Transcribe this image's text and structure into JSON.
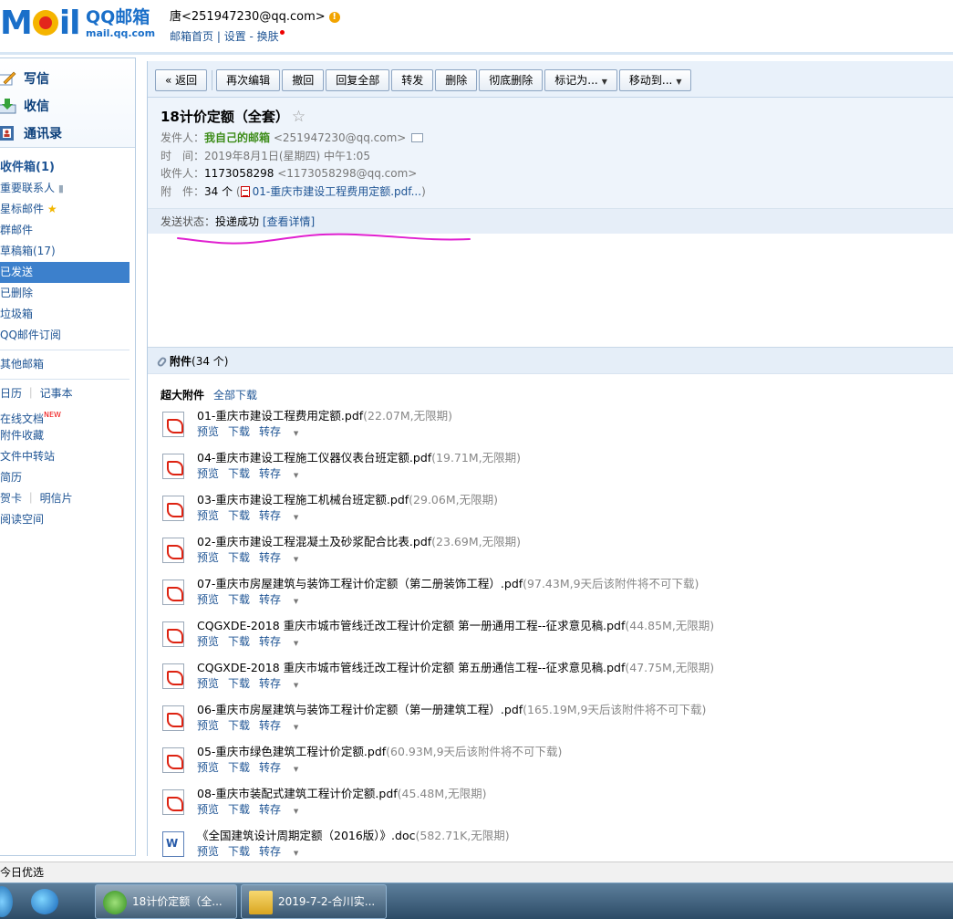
{
  "header": {
    "logo_text": "MOil",
    "brand_name": "QQ邮箱",
    "brand_domain": "mail.qq.com",
    "account_email": "唐<251947230@qq.com>",
    "links": [
      "邮箱首页",
      "设置",
      "换肤"
    ],
    "link_sep": " | ",
    "link_dash": " - "
  },
  "sidebar": {
    "actions": [
      "写信",
      "收信",
      "通讯录"
    ],
    "folders": [
      {
        "label": "收件箱(1)",
        "bold": true
      },
      {
        "label": "重要联系人"
      },
      {
        "label": "星标邮件"
      },
      {
        "label": "群邮件"
      },
      {
        "label": "草稿箱(17)"
      },
      {
        "label": "已发送",
        "selected": true
      },
      {
        "label": "已删除"
      },
      {
        "label": "垃圾箱"
      },
      {
        "label": "QQ邮件订阅"
      }
    ],
    "other_mailbox": "其他邮箱",
    "tools": {
      "calendar": "日历",
      "notes": "记事本",
      "docs": "在线文档",
      "docs_badge": "NEW",
      "favorites": "附件收藏",
      "transfer": "文件中转站",
      "resume": "简历",
      "card": "贺卡",
      "postcard": "明信片",
      "reading": "阅读空间"
    }
  },
  "toolbar": {
    "back": "« 返回",
    "reedit": "再次编辑",
    "recall": "撤回",
    "reply_all": "回复全部",
    "forward": "转发",
    "delete": "删除",
    "delete_perm": "彻底删除",
    "mark_as": "标记为...",
    "move_to": "移动到..."
  },
  "mail": {
    "subject": "18计价定额（全套）",
    "from_label": "发件人：",
    "from_name": "我自己的邮箱",
    "from_email": "<251947230@qq.com>",
    "time_label": "时　间：",
    "time_value": "2019年8月1日(星期四) 中午1:05",
    "to_label": "收件人：",
    "to_name": "1173058298",
    "to_email": "<1173058298@qq.com>",
    "att_label": "附　件：",
    "att_count": "34 个",
    "att_first": "01-重庆市建设工程费用定额.pdf...",
    "status_label": "发送状态：",
    "status_value": "投递成功",
    "status_link": "[查看详情]"
  },
  "attachments": {
    "title": "附件",
    "count": "(34 个)",
    "super_label": "超大附件",
    "download_all": "全部下载",
    "ops": [
      "预览",
      "下载",
      "转存"
    ],
    "items": [
      {
        "name": "01-重庆市建设工程费用定额.pdf",
        "meta": "(22.07M,无限期)",
        "type": "pdf"
      },
      {
        "name": "04-重庆市建设工程施工仪器仪表台班定额.pdf",
        "meta": "(19.71M,无限期)",
        "type": "pdf"
      },
      {
        "name": "03-重庆市建设工程施工机械台班定额.pdf",
        "meta": "(29.06M,无限期)",
        "type": "pdf"
      },
      {
        "name": "02-重庆市建设工程混凝土及砂浆配合比表.pdf",
        "meta": "(23.69M,无限期)",
        "type": "pdf"
      },
      {
        "name": "07-重庆市房屋建筑与装饰工程计价定额（第二册装饰工程）.pdf",
        "meta": "(97.43M,9天后该附件将不可下载)",
        "type": "pdf"
      },
      {
        "name": "CQGXDE-2018 重庆市城市管线迁改工程计价定额 第一册通用工程--征求意见稿.pdf",
        "meta": "(44.85M,无限期)",
        "type": "pdf"
      },
      {
        "name": "CQGXDE-2018 重庆市城市管线迁改工程计价定额 第五册通信工程--征求意见稿.pdf",
        "meta": "(47.75M,无限期)",
        "type": "pdf"
      },
      {
        "name": "06-重庆市房屋建筑与装饰工程计价定额（第一册建筑工程）.pdf",
        "meta": "(165.19M,9天后该附件将不可下载)",
        "type": "pdf"
      },
      {
        "name": "05-重庆市绿色建筑工程计价定额.pdf",
        "meta": "(60.93M,9天后该附件将不可下载)",
        "type": "pdf"
      },
      {
        "name": "08-重庆市装配式建筑工程计价定额.pdf",
        "meta": "(45.48M,无限期)",
        "type": "pdf"
      },
      {
        "name": "《全国建筑设计周期定额（2016版）》.doc",
        "meta": "(582.71K,无限期)",
        "type": "doc"
      }
    ]
  },
  "bottom_hint": "今日优选",
  "taskbar": {
    "task1": "18计价定额（全...",
    "task2": "2019-7-2-合川实..."
  },
  "colors": {
    "brand_blue": "#1a6fc9",
    "sender_green": "#3e8d1a",
    "selected_folder": "#3c80cc",
    "annotation_ink": "#e020d0"
  }
}
